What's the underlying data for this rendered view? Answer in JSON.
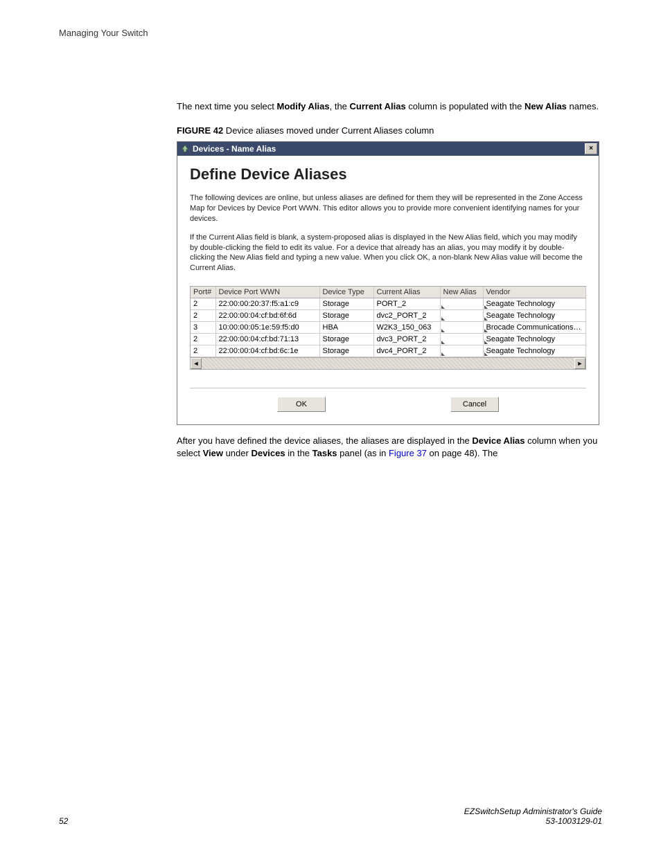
{
  "runningHead": "Managing Your Switch",
  "para1_before": "The next time you select ",
  "para1_b1": "Modify Alias",
  "para1_mid1": ", the ",
  "para1_b2": "Current Alias",
  "para1_mid2": " column is populated with the ",
  "para1_b3": "New Alias",
  "para1_after": " names.",
  "figLabel": "FIGURE 42",
  "figCaption": " Device aliases moved under Current Aliases column",
  "dialog": {
    "windowTitle": "Devices - Name Alias",
    "close": "×",
    "heading": "Define Device Aliases",
    "desc1": "The following devices are online, but unless aliases are defined for them they will be represented in the Zone Access Map for Devices by Device Port WWN. This editor allows you to provide more convenient identifying names for your devices.",
    "desc2": "If the Current Alias field is blank, a system-proposed alias is displayed in the New Alias field, which you may modify by double-clicking the field to edit its value. For a device that already has an alias, you may modify it by double-clicking the New Alias field and typing a new value. When you click OK, a non-blank New Alias value will become the Current Alias.",
    "columns": {
      "port": "Port#",
      "wwn": "Device Port WWN",
      "type": "Device Type",
      "current": "Current Alias",
      "newAlias": "New Alias",
      "vendor": "Vendor"
    },
    "rows": [
      {
        "port": "2",
        "wwn": "22:00:00:20:37:f5:a1:c9",
        "type": "Storage",
        "current": "PORT_2",
        "newAlias": "",
        "vendor": "Seagate Technology"
      },
      {
        "port": "2",
        "wwn": "22:00:00:04:cf:bd:6f:6d",
        "type": "Storage",
        "current": "dvc2_PORT_2",
        "newAlias": "",
        "vendor": "Seagate Technology"
      },
      {
        "port": "3",
        "wwn": "10:00:00:05:1e:59:f5:d0",
        "type": "HBA",
        "current": "W2K3_150_063",
        "newAlias": "",
        "vendor": "Brocade Communications Sy..."
      },
      {
        "port": "2",
        "wwn": "22:00:00:04:cf:bd:71:13",
        "type": "Storage",
        "current": "dvc3_PORT_2",
        "newAlias": "",
        "vendor": "Seagate Technology"
      },
      {
        "port": "2",
        "wwn": "22:00:00:04:cf:bd:6c:1e",
        "type": "Storage",
        "current": "dvc4_PORT_2",
        "newAlias": "",
        "vendor": "Seagate Technology"
      }
    ],
    "okLabel": "OK",
    "cancelLabel": "Cancel",
    "scrollLeft": "◄",
    "scrollRight": "►"
  },
  "para2_before": "After you have defined the device aliases, the aliases are displayed in the ",
  "para2_b1": "Device Alias",
  "para2_mid1": " column when you select ",
  "para2_b2": "View",
  "para2_mid2": " under ",
  "para2_b3": "Devices",
  "para2_mid3": " in the ",
  "para2_b4": "Tasks",
  "para2_mid4": " panel (as in ",
  "para2_link": "Figure 37",
  "para2_after": " on page 48). The",
  "footer": {
    "pageNum": "52",
    "guide": "EZSwitchSetup Administrator's Guide",
    "docnum": "53-1003129-01"
  }
}
